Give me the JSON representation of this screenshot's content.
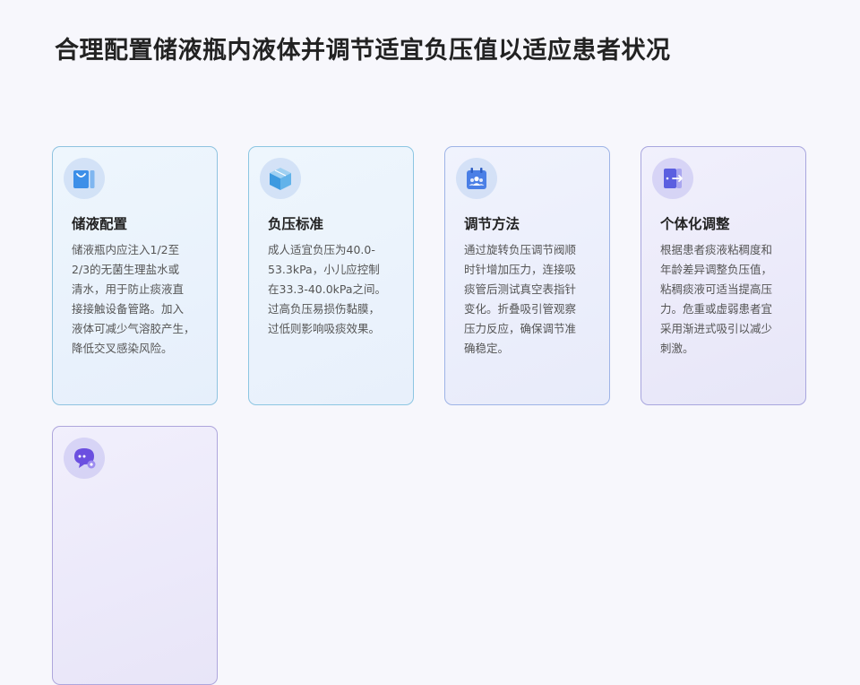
{
  "page": {
    "title": "合理配置储液瓶内液体并调节适宜负压值以适应患者状况"
  },
  "cards": [
    {
      "icon": "bag-icon",
      "title": "储液配置",
      "lines": [
        "储液瓶内应注入1/2至",
        "2/3的无菌生理盐水或",
        "清水，用于防止痰液直",
        "接接触设备管路。加入",
        "液体可减少气溶胶产生，",
        "降低交叉感染风险。"
      ]
    },
    {
      "icon": "box-icon",
      "title": "负压标准",
      "lines": [
        "成人适宜负压为40.0-",
        "53.3kPa，小儿应控制",
        "在33.3-40.0kPa之间。",
        "过高负压易损伤黏膜，",
        "过低则影响吸痰效果。"
      ]
    },
    {
      "icon": "calendar-team-icon",
      "title": "调节方法",
      "lines": [
        "通过旋转负压调节阀顺",
        "时针增加压力，连接吸",
        "痰管后测试真空表指针",
        "变化。折叠吸引管观察",
        "压力反应，确保调节准",
        "确稳定。"
      ]
    },
    {
      "icon": "door-exit-icon",
      "title": "个体化调整",
      "lines": [
        "根据患者痰液粘稠度和",
        "年龄差异调整负压值，",
        "粘稠痰液可适当提高压",
        "力。危重或虚弱患者宜",
        "采用渐进式吸引以减少",
        "刺激。"
      ]
    },
    {
      "icon": "chat-gear-icon",
      "title": "",
      "lines": []
    }
  ],
  "colors": {
    "icon_blue": "#3d8fe8",
    "icon_indigo": "#5b5fe0",
    "icon_violet": "#6b4fe0"
  }
}
